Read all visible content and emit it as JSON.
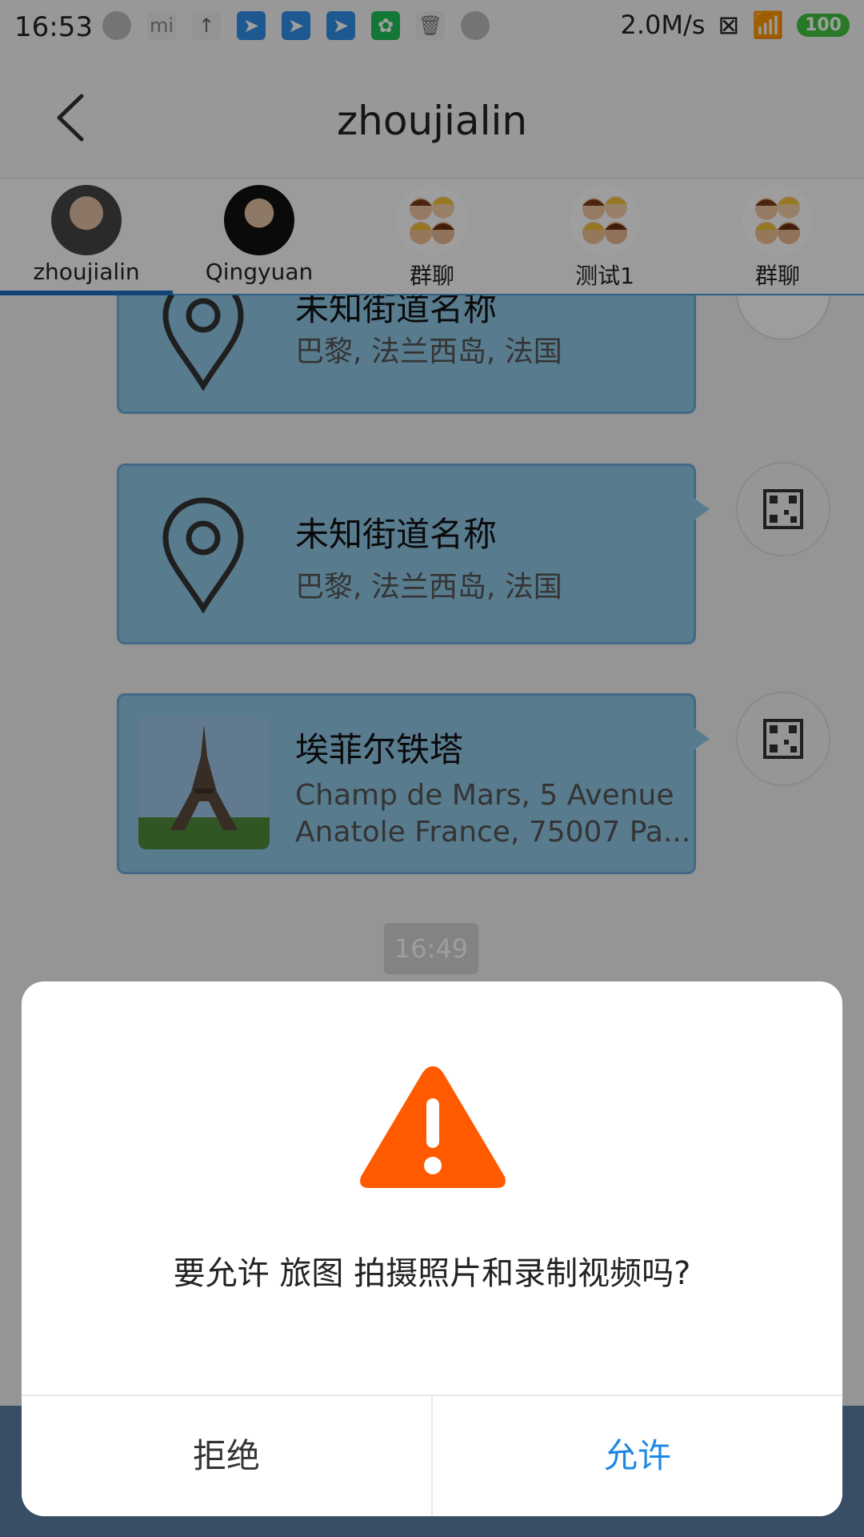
{
  "status_bar": {
    "time": "16:53",
    "network_speed": "2.0M/s",
    "battery": "100",
    "icons": [
      "circle-notification-icon",
      "mi-store-icon",
      "upload-icon",
      "paper-plane-icon",
      "paper-plane-icon",
      "paper-plane-icon",
      "leaf-app-icon",
      "trash-icon",
      "circle-notification-icon",
      "sim-x-icon",
      "wifi-icon",
      "battery-icon"
    ]
  },
  "header": {
    "title": "zhoujialin",
    "back_icon": "chevron-left-icon"
  },
  "tabs": [
    {
      "label": "zhoujialin",
      "active": true
    },
    {
      "label": "Qingyuan",
      "active": false
    },
    {
      "label": "群聊",
      "active": false
    },
    {
      "label": "测试1",
      "active": false
    },
    {
      "label": "群聊",
      "active": false
    }
  ],
  "messages": [
    {
      "name": "未知街道名称",
      "address": "巴黎, 法兰西岛, 法国"
    },
    {
      "name": "未知街道名称",
      "address": "巴黎, 法兰西岛, 法国"
    },
    {
      "name": "埃菲尔铁塔",
      "address_line1": "Champ de Mars, 5 Avenue",
      "address_line2": "Anatole France, 75007 Pa..."
    }
  ],
  "time_chip": "16:49",
  "dialog": {
    "message": "要允许 旅图 拍摄照片和录制视频吗?",
    "deny_label": "拒绝",
    "allow_label": "允许",
    "warning_color": "#ff5a00",
    "allow_color": "#1e88e5"
  }
}
